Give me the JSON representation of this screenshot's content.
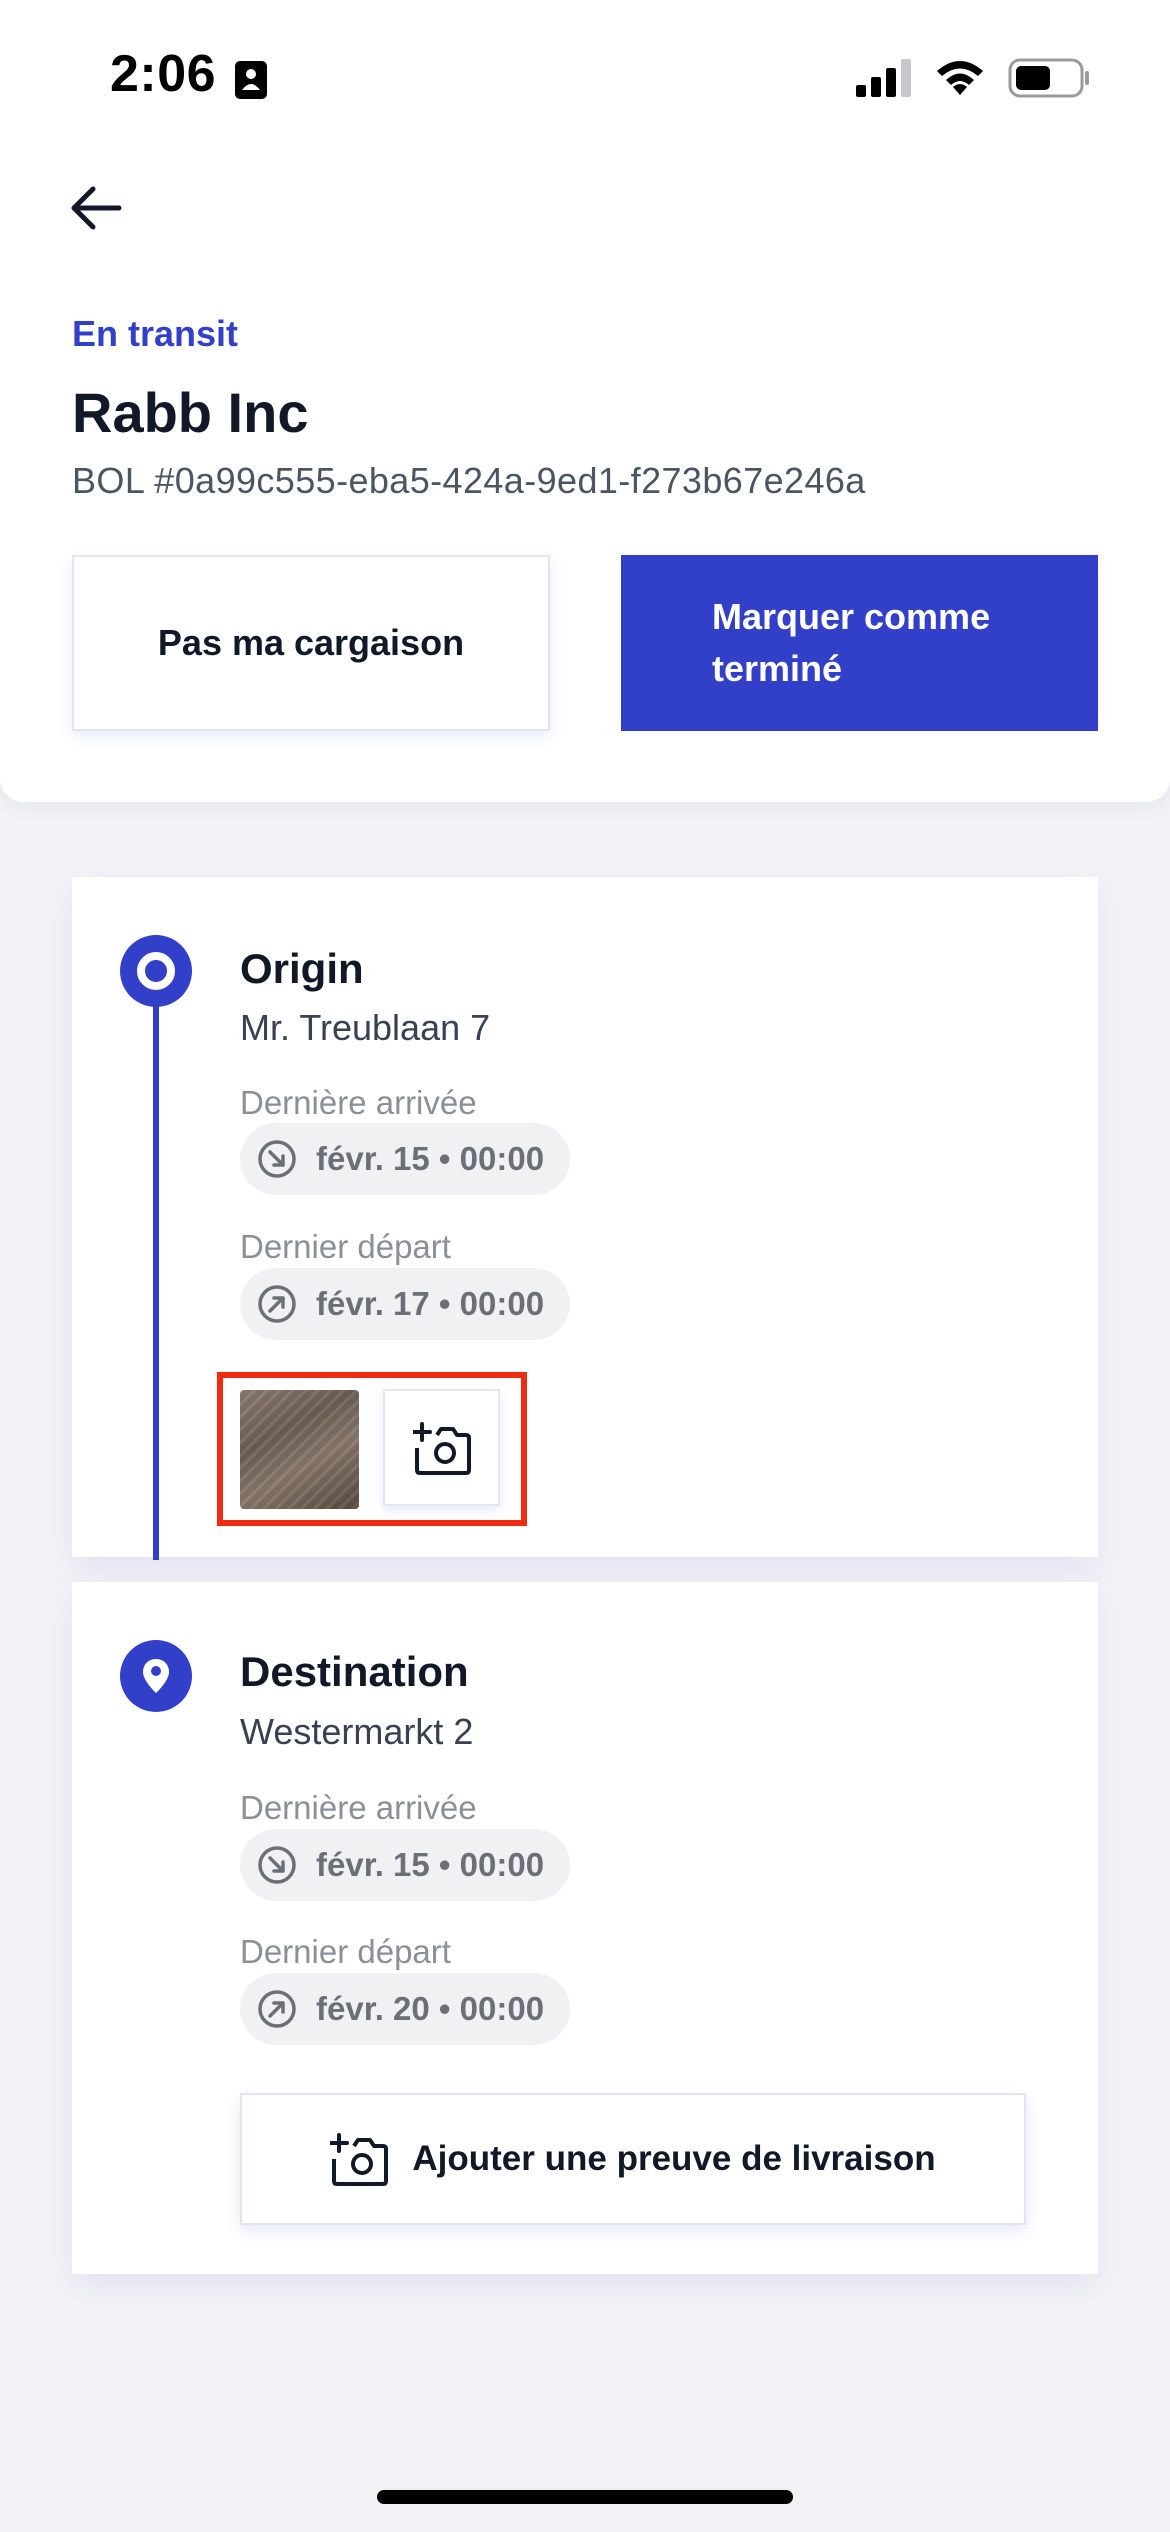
{
  "status_bar": {
    "time": "2:06"
  },
  "header": {
    "status": "En transit",
    "company": "Rabb Inc",
    "bol": "BOL #0a99c555-eba5-424a-9ed1-f273b67e246a",
    "buttons": {
      "not_my_load": "Pas ma cargaison",
      "mark_done": "Marquer comme terminé"
    }
  },
  "stops": {
    "origin": {
      "title": "Origin",
      "address": "Mr. Treublaan 7",
      "arrival_label": "Dernière arrivée",
      "arrival_value": "févr. 15 • 00:00",
      "departure_label": "Dernier départ",
      "departure_value": "févr. 17 • 00:00"
    },
    "destination": {
      "title": "Destination",
      "address": "Westermarkt 2",
      "arrival_label": "Dernière arrivée",
      "arrival_value": "févr. 15 • 00:00",
      "departure_label": "Dernier départ",
      "departure_value": "févr. 20 • 00:00",
      "proof_button": "Ajouter une preuve de livraison"
    }
  },
  "colors": {
    "accent": "#3240c9",
    "highlight": "#ef2b12"
  },
  "icons": {
    "back": "arrow-left-icon",
    "arrival": "arrow-down-right-circle-icon",
    "departure": "arrow-up-right-circle-icon",
    "add_photo": "camera-plus-icon",
    "destination_node": "map-pin-icon"
  }
}
